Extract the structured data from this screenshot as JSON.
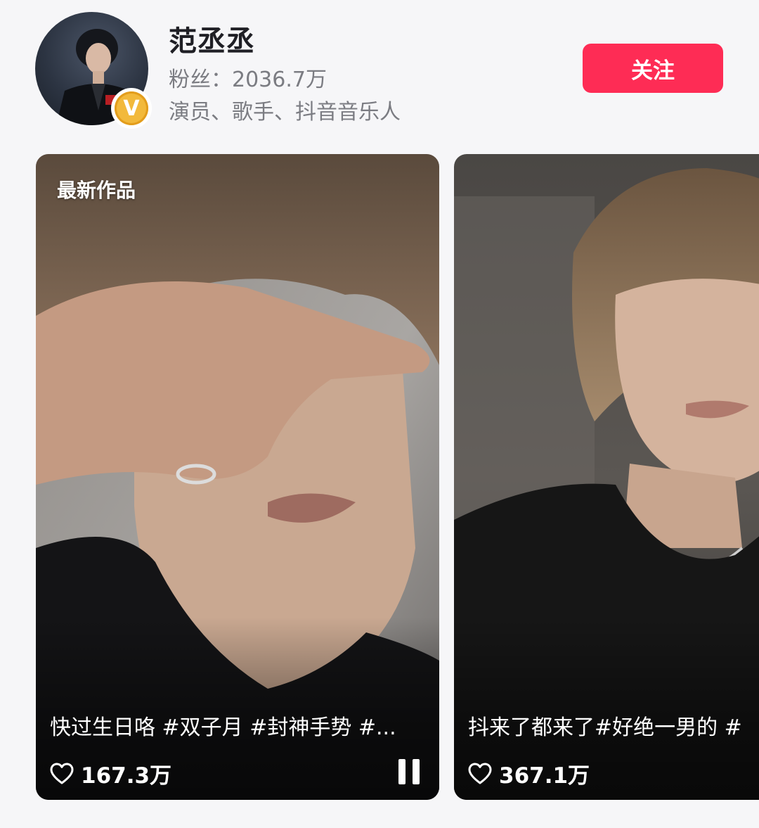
{
  "profile": {
    "name": "范丞丞",
    "fans": "粉丝：2036.7万",
    "tags": "演员、歌手、抖音音乐人",
    "avatar_icon": "avatar-photo",
    "verified_icon": "verified-v-badge",
    "verified_letter": "V",
    "verified_color": "#f2b93b"
  },
  "follow_button": {
    "label": "关注",
    "color": "#fe2c55"
  },
  "videos": [
    {
      "badge": "最新作品",
      "caption": "快过生日咯 #双子月 #封神手势 #...",
      "likes": "167.3万",
      "like_icon": "heart-outline-icon",
      "playback_icon": "pause-icon"
    },
    {
      "caption": "抖来了都来了#好绝一男的 #",
      "likes": "367.1万",
      "like_icon": "heart-outline-icon"
    }
  ]
}
